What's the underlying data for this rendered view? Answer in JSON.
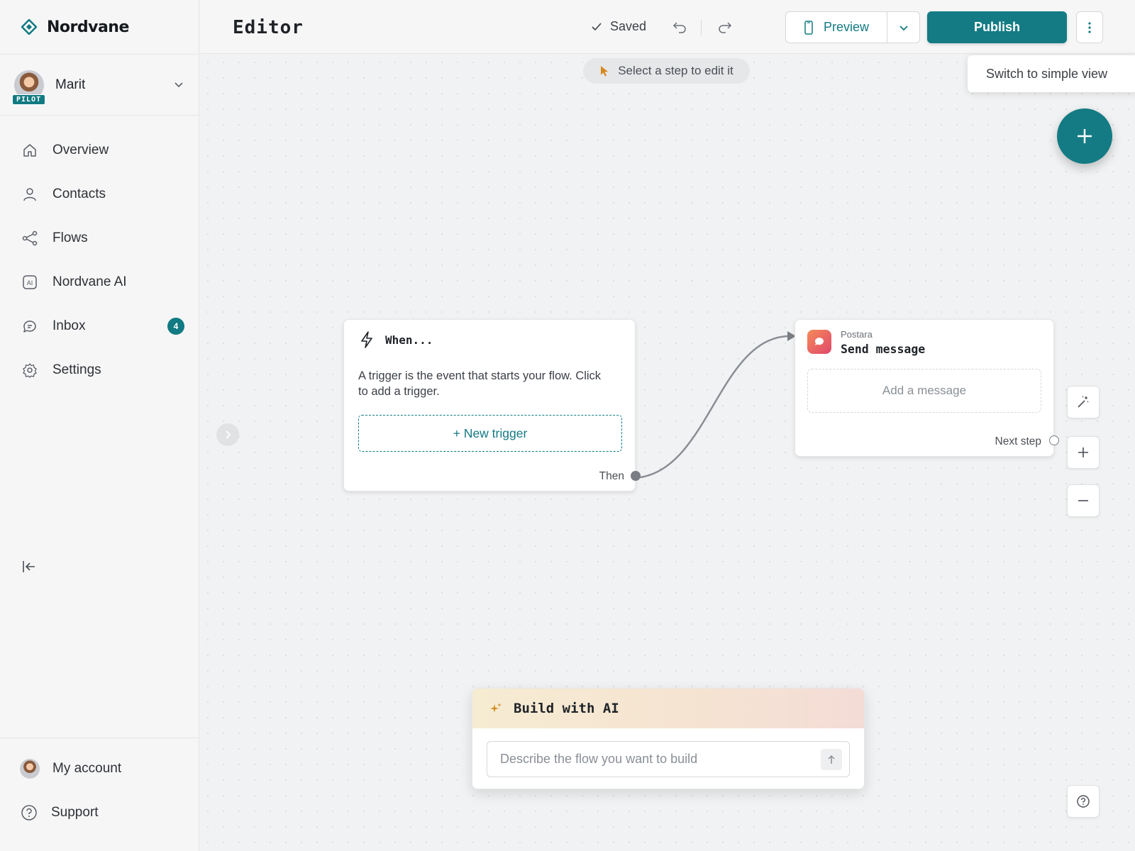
{
  "brand": {
    "name": "Nordvane"
  },
  "user": {
    "name": "Marit",
    "badge": "PILOT"
  },
  "nav": {
    "items": [
      {
        "label": "Overview",
        "icon": "home-icon"
      },
      {
        "label": "Contacts",
        "icon": "person-icon"
      },
      {
        "label": "Flows",
        "icon": "share-nodes-icon"
      },
      {
        "label": "Nordvane AI",
        "icon": "ai-icon"
      },
      {
        "label": "Inbox",
        "icon": "chat-bubble-icon",
        "badge": "4"
      },
      {
        "label": "Settings",
        "icon": "gear-icon"
      }
    ]
  },
  "footer": {
    "account_label": "My account",
    "support_label": "Support"
  },
  "topbar": {
    "title": "Editor",
    "saved_label": "Saved",
    "preview_label": "Preview",
    "publish_label": "Publish"
  },
  "canvas": {
    "hint": "Select a step to edit it",
    "simple_view_label": "Switch to simple view"
  },
  "trigger_node": {
    "title": "When...",
    "description": "A trigger is the event that starts your flow. Click to add a trigger.",
    "button_label": "+ New trigger",
    "port_label": "Then"
  },
  "message_node": {
    "app": "Postara",
    "title": "Send message",
    "placeholder": "Add a message",
    "port_label": "Next step"
  },
  "ai_panel": {
    "title": "Build with AI",
    "placeholder": "Describe the flow you want to build"
  },
  "colors": {
    "accent": "#147b84",
    "badge": "#117a82"
  }
}
